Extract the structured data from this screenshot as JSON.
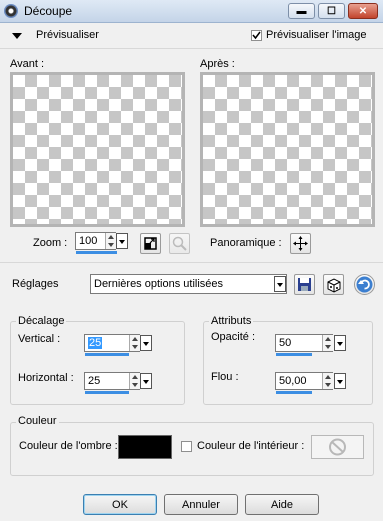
{
  "window": {
    "title": "Découpe",
    "minimize_icon": "minimize-icon",
    "maximize_icon": "maximize-icon",
    "close_icon": "close-icon"
  },
  "preview_section": {
    "label": "Prévisualiser",
    "checkbox_label": "Prévisualiser l'image",
    "checkbox_checked": true
  },
  "before": {
    "label": "Avant :"
  },
  "after": {
    "label": "Après :"
  },
  "zoom": {
    "label": "Zoom :",
    "value": "100"
  },
  "pan": {
    "label": "Panoramique :"
  },
  "presets": {
    "label": "Réglages",
    "value": "Dernières options utilisées"
  },
  "offset": {
    "title": "Décalage",
    "vertical_label": "Vertical :",
    "vertical_value": "25",
    "horizontal_label": "Horizontal :",
    "horizontal_value": "25"
  },
  "attributes": {
    "title": "Attributs",
    "opacity_label": "Opacité :",
    "opacity_value": "50",
    "blur_label": "Flou :",
    "blur_value": "50,00"
  },
  "color": {
    "title": "Couleur",
    "shadow_label": "Couleur de l'ombre :",
    "shadow_color": "#000000",
    "inner_label": "Couleur de l'intérieur :",
    "inner_checked": false
  },
  "buttons": {
    "ok": "OK",
    "cancel": "Annuler",
    "help": "Aide"
  },
  "accent_color": "#3c8ee3"
}
